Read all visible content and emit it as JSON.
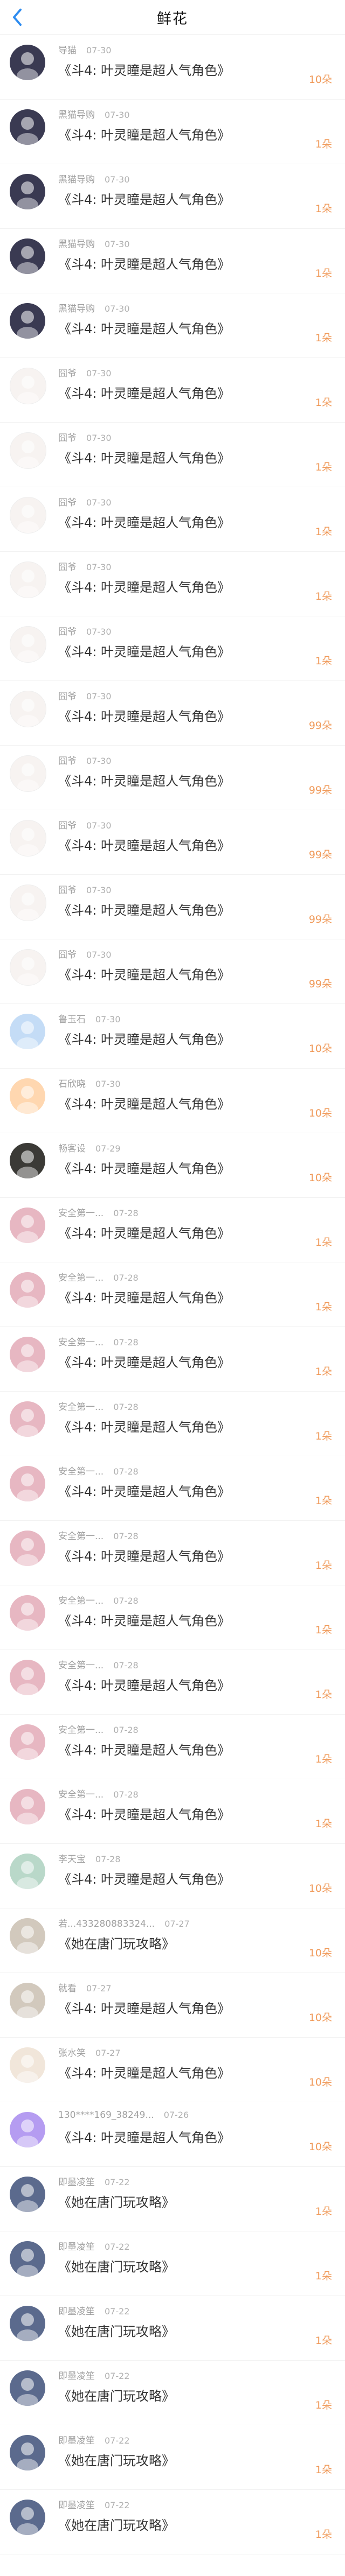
{
  "header": {
    "title": "鲜花"
  },
  "rows": [
    {
      "name": "导猫",
      "time": "07-30",
      "book": "《斗4: 叶灵瞳是超人气角色》",
      "amount": "10朵",
      "avatar": "av-girl-dark"
    },
    {
      "name": "黑猫导购",
      "time": "07-30",
      "book": "《斗4: 叶灵瞳是超人气角色》",
      "amount": "1朵",
      "avatar": "av-girl-dark"
    },
    {
      "name": "黑猫导购",
      "time": "07-30",
      "book": "《斗4: 叶灵瞳是超人气角色》",
      "amount": "1朵",
      "avatar": "av-girl-dark"
    },
    {
      "name": "黑猫导购",
      "time": "07-30",
      "book": "《斗4: 叶灵瞳是超人气角色》",
      "amount": "1朵",
      "avatar": "av-girl-dark"
    },
    {
      "name": "黑猫导购",
      "time": "07-30",
      "book": "《斗4: 叶灵瞳是超人气角色》",
      "amount": "1朵",
      "avatar": "av-girl-dark"
    },
    {
      "name": "囧爷",
      "time": "07-30",
      "book": "《斗4: 叶灵瞳是超人气角色》",
      "amount": "1朵",
      "avatar": "av-pig"
    },
    {
      "name": "囧爷",
      "time": "07-30",
      "book": "《斗4: 叶灵瞳是超人气角色》",
      "amount": "1朵",
      "avatar": "av-pig"
    },
    {
      "name": "囧爷",
      "time": "07-30",
      "book": "《斗4: 叶灵瞳是超人气角色》",
      "amount": "1朵",
      "avatar": "av-pig"
    },
    {
      "name": "囧爷",
      "time": "07-30",
      "book": "《斗4: 叶灵瞳是超人气角色》",
      "amount": "1朵",
      "avatar": "av-pig"
    },
    {
      "name": "囧爷",
      "time": "07-30",
      "book": "《斗4: 叶灵瞳是超人气角色》",
      "amount": "1朵",
      "avatar": "av-pig"
    },
    {
      "name": "囧爷",
      "time": "07-30",
      "book": "《斗4: 叶灵瞳是超人气角色》",
      "amount": "99朵",
      "avatar": "av-pig"
    },
    {
      "name": "囧爷",
      "time": "07-30",
      "book": "《斗4: 叶灵瞳是超人气角色》",
      "amount": "99朵",
      "avatar": "av-pig"
    },
    {
      "name": "囧爷",
      "time": "07-30",
      "book": "《斗4: 叶灵瞳是超人气角色》",
      "amount": "99朵",
      "avatar": "av-pig"
    },
    {
      "name": "囧爷",
      "time": "07-30",
      "book": "《斗4: 叶灵瞳是超人气角色》",
      "amount": "99朵",
      "avatar": "av-pig"
    },
    {
      "name": "囧爷",
      "time": "07-30",
      "book": "《斗4: 叶灵瞳是超人气角色》",
      "amount": "99朵",
      "avatar": "av-pig"
    },
    {
      "name": "鲁玉石",
      "time": "07-30",
      "book": "《斗4: 叶灵瞳是超人气角色》",
      "amount": "10朵",
      "avatar": "av-star"
    },
    {
      "name": "石欣晓",
      "time": "07-30",
      "book": "《斗4: 叶灵瞳是超人气角色》",
      "amount": "10朵",
      "avatar": "av-cat"
    },
    {
      "name": "畅客设",
      "time": "07-29",
      "book": "《斗4: 叶灵瞳是超人气角色》",
      "amount": "10朵",
      "avatar": "av-dog"
    },
    {
      "name": "安全第一...",
      "time": "07-28",
      "book": "《斗4: 叶灵瞳是超人气角色》",
      "amount": "1朵",
      "avatar": "av-pink"
    },
    {
      "name": "安全第一...",
      "time": "07-28",
      "book": "《斗4: 叶灵瞳是超人气角色》",
      "amount": "1朵",
      "avatar": "av-pink"
    },
    {
      "name": "安全第一...",
      "time": "07-28",
      "book": "《斗4: 叶灵瞳是超人气角色》",
      "amount": "1朵",
      "avatar": "av-pink"
    },
    {
      "name": "安全第一...",
      "time": "07-28",
      "book": "《斗4: 叶灵瞳是超人气角色》",
      "amount": "1朵",
      "avatar": "av-pink"
    },
    {
      "name": "安全第一...",
      "time": "07-28",
      "book": "《斗4: 叶灵瞳是超人气角色》",
      "amount": "1朵",
      "avatar": "av-pink"
    },
    {
      "name": "安全第一...",
      "time": "07-28",
      "book": "《斗4: 叶灵瞳是超人气角色》",
      "amount": "1朵",
      "avatar": "av-pink"
    },
    {
      "name": "安全第一...",
      "time": "07-28",
      "book": "《斗4: 叶灵瞳是超人气角色》",
      "amount": "1朵",
      "avatar": "av-pink"
    },
    {
      "name": "安全第一...",
      "time": "07-28",
      "book": "《斗4: 叶灵瞳是超人气角色》",
      "amount": "1朵",
      "avatar": "av-pink"
    },
    {
      "name": "安全第一...",
      "time": "07-28",
      "book": "《斗4: 叶灵瞳是超人气角色》",
      "amount": "1朵",
      "avatar": "av-pink"
    },
    {
      "name": "安全第一...",
      "time": "07-28",
      "book": "《斗4: 叶灵瞳是超人气角色》",
      "amount": "1朵",
      "avatar": "av-pink"
    },
    {
      "name": "李天宝",
      "time": "07-28",
      "book": "《斗4: 叶灵瞳是超人气角色》",
      "amount": "10朵",
      "avatar": "av-green"
    },
    {
      "name": "若...433280883324...",
      "time": "07-27",
      "book": "《她在唐门玩攻略》",
      "amount": "10朵",
      "avatar": "av-sketch"
    },
    {
      "name": "就看",
      "time": "07-27",
      "book": "《斗4: 叶灵瞳是超人气角色》",
      "amount": "10朵",
      "avatar": "av-sketch"
    },
    {
      "name": "张水笑",
      "time": "07-27",
      "book": "《斗4: 叶灵瞳是超人气角色》",
      "amount": "10朵",
      "avatar": "av-beige"
    },
    {
      "name": "130****169_38249...",
      "time": "07-26",
      "book": "《斗4: 叶灵瞳是超人气角色》",
      "amount": "10朵",
      "avatar": "av-bubble"
    },
    {
      "name": "即墨凌笙",
      "time": "07-22",
      "book": "《她在唐门玩攻略》",
      "amount": "1朵",
      "avatar": "av-purple"
    },
    {
      "name": "即墨凌笙",
      "time": "07-22",
      "book": "《她在唐门玩攻略》",
      "amount": "1朵",
      "avatar": "av-purple"
    },
    {
      "name": "即墨凌笙",
      "time": "07-22",
      "book": "《她在唐门玩攻略》",
      "amount": "1朵",
      "avatar": "av-purple"
    },
    {
      "name": "即墨凌笙",
      "time": "07-22",
      "book": "《她在唐门玩攻略》",
      "amount": "1朵",
      "avatar": "av-purple"
    },
    {
      "name": "即墨凌笙",
      "time": "07-22",
      "book": "《她在唐门玩攻略》",
      "amount": "1朵",
      "avatar": "av-purple"
    },
    {
      "name": "即墨凌笙",
      "time": "07-22",
      "book": "《她在唐门玩攻略》",
      "amount": "1朵",
      "avatar": "av-purple"
    }
  ]
}
